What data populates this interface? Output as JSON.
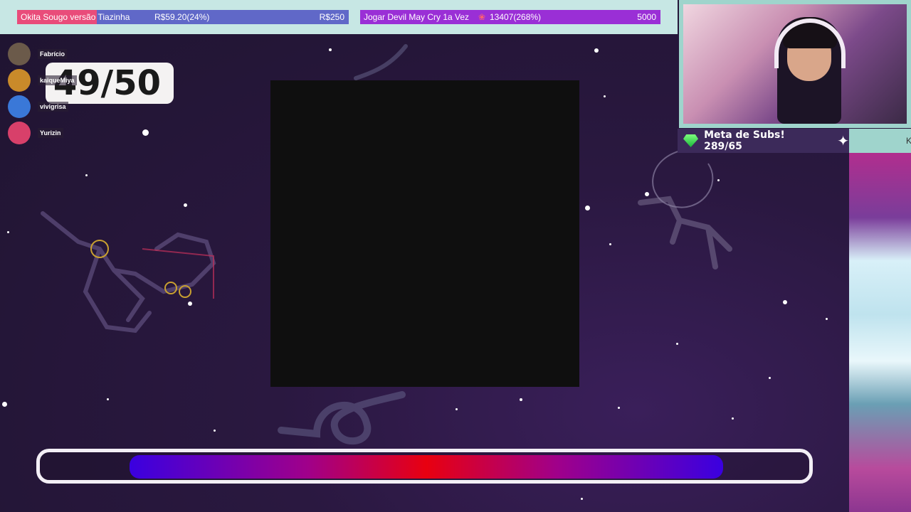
{
  "goals": [
    {
      "name": "Okita Sougo versão Tiazinha",
      "current": "R$59.20(24%)",
      "target": "R$250",
      "progress": 0.24,
      "color_fill": "#e94c7a",
      "color_bg": "#6068c8"
    },
    {
      "name": "Jogar Devil May Cry 1a Vez",
      "current": "13407(268%)",
      "target": "5000",
      "progress": 1.0,
      "color_bg": "#9a2fd6",
      "icon": "flower-icon"
    }
  ],
  "subs_goal": {
    "label": "Meta de Subs! 289/65",
    "icon": "gem-icon",
    "extra_icon": "sparkle-icon",
    "right_text": "K"
  },
  "counter": {
    "value": "49/50"
  },
  "chat": [
    {
      "user": "Fabrício",
      "avatar_color": "#6b5a4a"
    },
    {
      "user": "kaiqueMiya",
      "avatar_color": "#c98a2a"
    },
    {
      "user": "vivigrisa",
      "avatar_color": "#3a78d8"
    },
    {
      "user": "Yurizin",
      "avatar_color": "#d8406a"
    }
  ],
  "progress_bar": {
    "fill_fraction": 0.76
  }
}
